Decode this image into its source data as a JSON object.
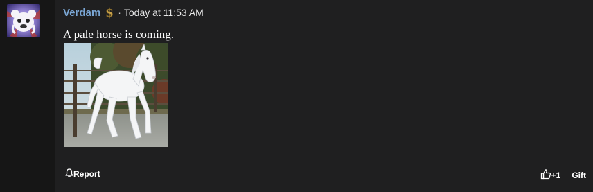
{
  "post": {
    "author": {
      "name": "Verdam",
      "badge_icon": "dollar-badge-icon",
      "name_color": "#7aa6d4"
    },
    "separator": "·",
    "timestamp": "Today at 11:53 AM",
    "message": "A pale horse is coming.",
    "image": {
      "subject": "white-horse-photo"
    }
  },
  "actions": {
    "report_label": "Report",
    "like_label": "+1",
    "gift_label": "Gift"
  },
  "colors": {
    "background": "#161616",
    "post_background": "#1f1f20",
    "text": "#ffffff",
    "badge_gold": "#c9a24a"
  }
}
